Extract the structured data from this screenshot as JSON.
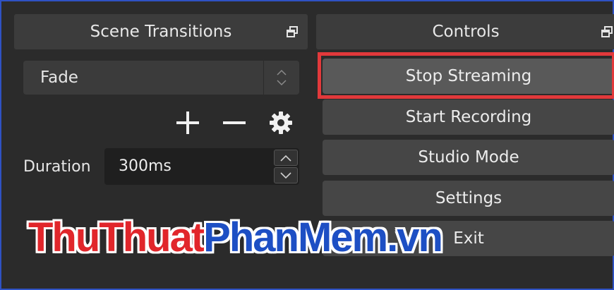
{
  "scene_transitions": {
    "title": "Scene Transitions",
    "float_icon": "float-dock-icon",
    "transition_select": {
      "value": "Fade"
    },
    "tools": {
      "add": "plus-icon",
      "remove": "minus-icon",
      "settings": "gear-icon"
    },
    "duration": {
      "label": "Duration",
      "value": "300ms"
    }
  },
  "controls": {
    "title": "Controls",
    "float_icon": "float-dock-icon",
    "buttons": {
      "stop_streaming": "Stop Streaming",
      "start_recording": "Start Recording",
      "studio_mode": "Studio Mode",
      "settings": "Settings",
      "exit": "Exit"
    },
    "highlight_color": "#e2393b"
  },
  "watermark": {
    "part1": "ThuThuat",
    "part2": "PhanMem.vn"
  },
  "colors": {
    "background": "#2b2b2b",
    "button": "#464646",
    "frame": "#2f52c4"
  }
}
